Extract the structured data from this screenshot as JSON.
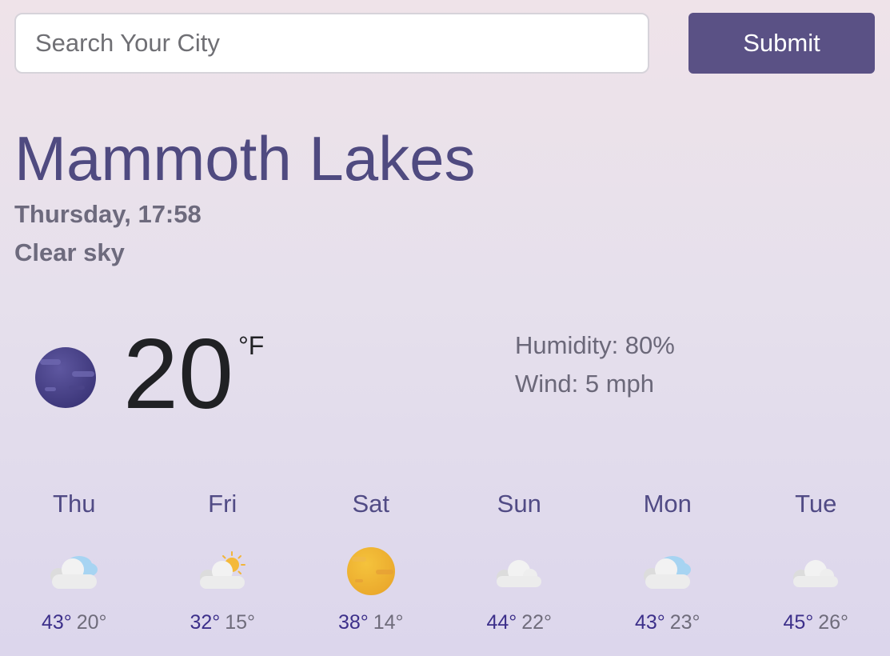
{
  "search": {
    "placeholder": "Search Your City",
    "value": ""
  },
  "submit_label": "Submit",
  "weather": {
    "city": "Mammoth Lakes",
    "date": "Thursday, 17:58",
    "description": "Clear sky",
    "temperature": "20",
    "unit": "°F",
    "icon": "clear-night-icon",
    "humidity": "Humidity: 80%",
    "wind": "Wind: 5 mph"
  },
  "forecast": [
    {
      "day": "Thu",
      "icon": "partly-cloudy-icon",
      "max": "43°",
      "min": "20°"
    },
    {
      "day": "Fri",
      "icon": "sun-cloud-icon",
      "max": "32°",
      "min": "15°"
    },
    {
      "day": "Sat",
      "icon": "sun-icon",
      "max": "38°",
      "min": "14°"
    },
    {
      "day": "Sun",
      "icon": "cloud-icon",
      "max": "44°",
      "min": "22°"
    },
    {
      "day": "Mon",
      "icon": "partly-cloudy-icon",
      "max": "43°",
      "min": "23°"
    },
    {
      "day": "Tue",
      "icon": "cloud-icon",
      "max": "45°",
      "min": "26°"
    }
  ],
  "colors": {
    "accent": "#5a5185",
    "city_text": "#4f4a80",
    "max_temp": "#3c2f8a"
  }
}
